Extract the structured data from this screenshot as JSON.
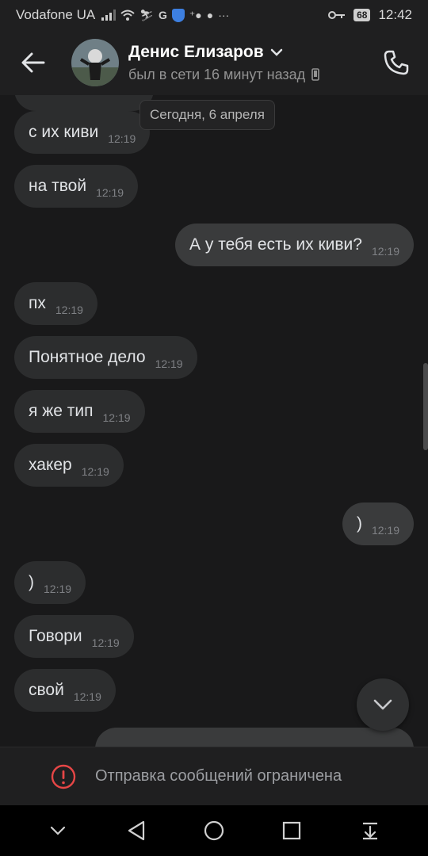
{
  "status_bar": {
    "carrier": "Vodafone UA",
    "battery": "68",
    "time": "12:42",
    "icons": [
      "signal-icon",
      "wifi-icon",
      "g-icon",
      "shield-icon",
      "add-contact-icon",
      "chat-icon",
      "more-icon",
      "key-icon",
      "battery-icon"
    ]
  },
  "header": {
    "name": "Денис Елизаров",
    "status": "был в сети 16 минут назад",
    "icons": [
      "back-arrow-icon",
      "chevron-down-icon",
      "mobile-device-icon",
      "phone-icon"
    ]
  },
  "chat": {
    "date_separator": "Сегодня, 6 апреля",
    "messages": [
      {
        "text": "с их киви",
        "time": "12:19",
        "dir": "in"
      },
      {
        "text": "на твой",
        "time": "12:19",
        "dir": "in"
      },
      {
        "text": "А у тебя есть их киви?",
        "time": "12:19",
        "dir": "out"
      },
      {
        "text": "пх",
        "time": "12:19",
        "dir": "in"
      },
      {
        "text": "Понятное дело",
        "time": "12:19",
        "dir": "in"
      },
      {
        "text": "я же тип",
        "time": "12:19",
        "dir": "in"
      },
      {
        "text": "хакер",
        "time": "12:19",
        "dir": "in"
      },
      {
        "text": ")",
        "time": "12:19",
        "dir": "out"
      },
      {
        "text": ")",
        "time": "12:19",
        "dir": "in"
      },
      {
        "text": "Говори",
        "time": "12:19",
        "dir": "in"
      },
      {
        "text": "свой",
        "time": "12:19",
        "dir": "in"
      }
    ],
    "scroll_down_icon": "chevron-down-icon"
  },
  "restriction": {
    "text": "Отправка сообщений ограничена",
    "icon": "warning-icon",
    "color": "#e64646"
  },
  "nav_bar": {
    "buttons": [
      "collapse-icon",
      "back-triangle-icon",
      "home-circle-icon",
      "recents-square-icon",
      "notifications-pull-icon"
    ]
  },
  "colors": {
    "background": "#19191a",
    "bubble_in": "#2c2d2e",
    "bubble_out": "#3a3b3c",
    "accent_warning": "#e64646"
  }
}
